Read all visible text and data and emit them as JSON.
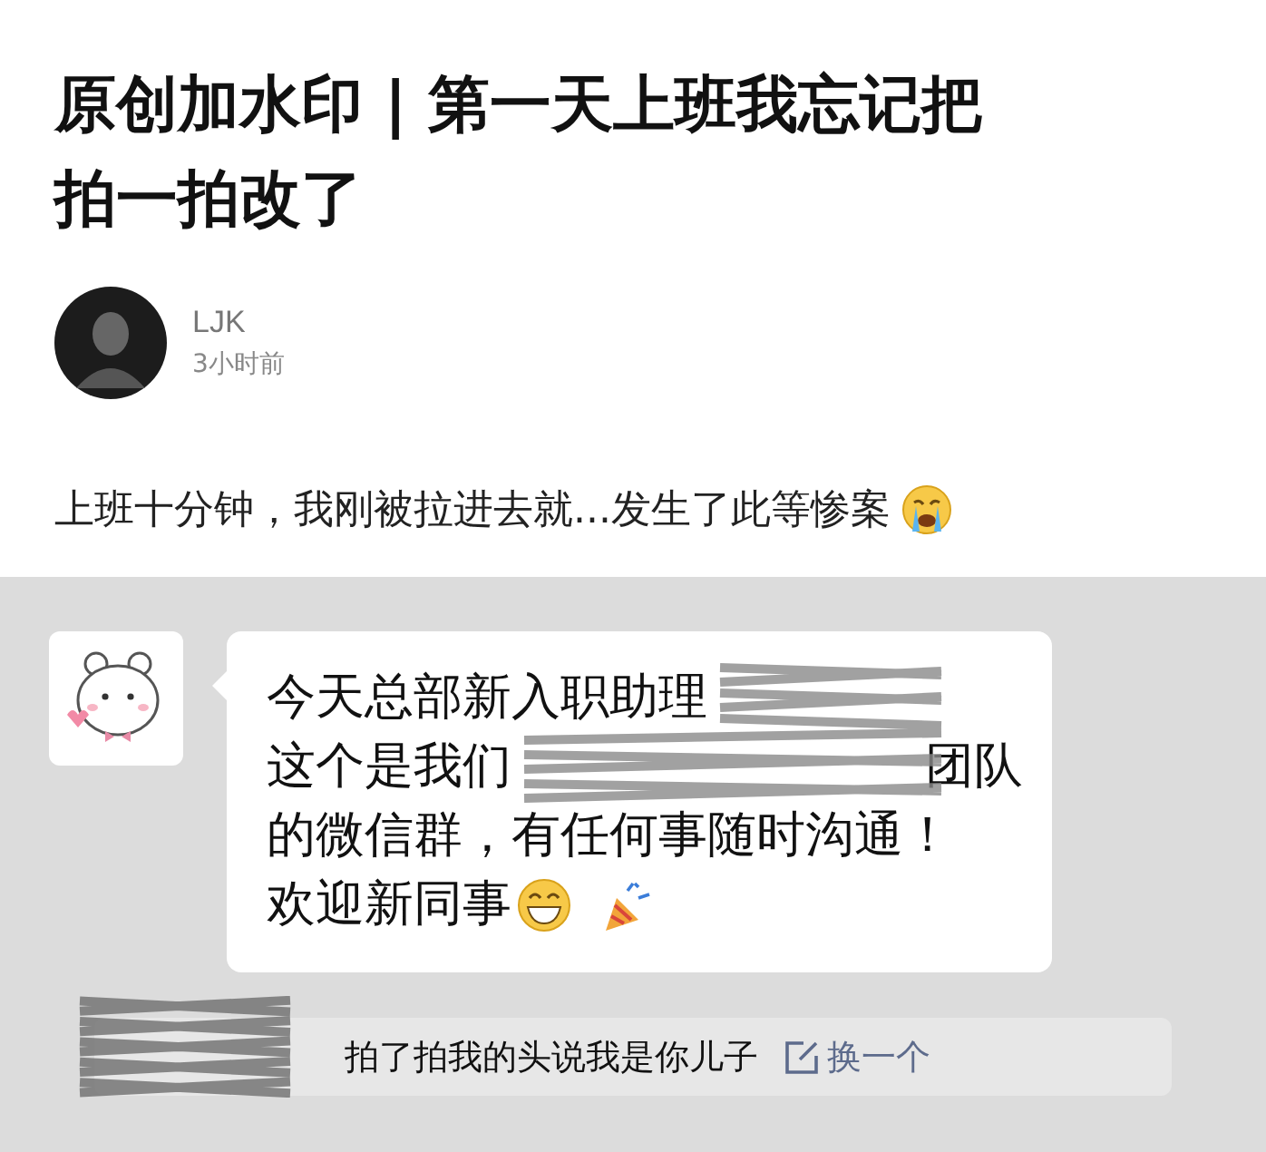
{
  "article": {
    "title": "原创加水印 | 第一天上班我忘记把拍一拍改了",
    "author": {
      "name": "LJK",
      "time": "3小时前"
    },
    "body": "上班十分钟，我刚被拉进去就...发生了此等惨案"
  },
  "chat": {
    "message_lines": [
      "今天总部新入职助理",
      "这个是我们",
      "团队",
      "的微信群，有任何事随时沟通！",
      "欢迎新同事"
    ],
    "pat_notice": {
      "text": "拍了拍我的头说我是你儿子",
      "action": "换一个"
    }
  }
}
